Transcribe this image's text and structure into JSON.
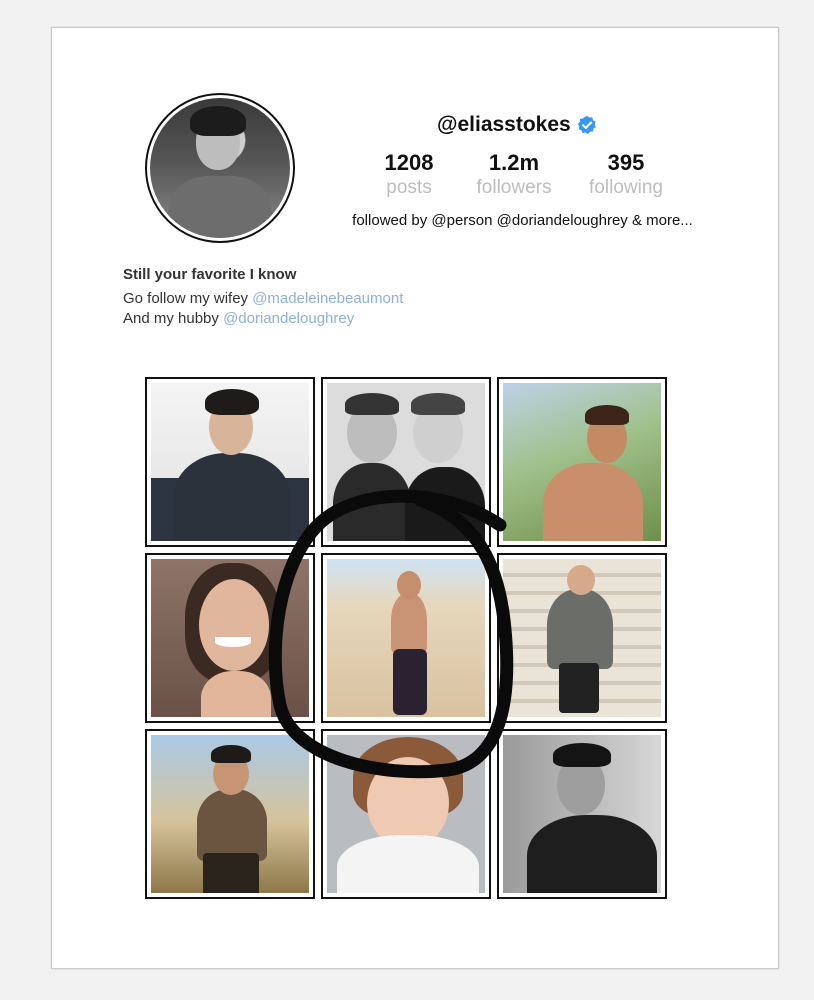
{
  "profile": {
    "handle": "@eliasstokes",
    "verified_icon": "verified-badge-icon",
    "accent_color": "#3897f0",
    "stats": [
      {
        "value": "1208",
        "label": "posts"
      },
      {
        "value": "1.2m",
        "label": "followers"
      },
      {
        "value": "395",
        "label": "following"
      }
    ],
    "followed_by": "followed by @person @doriandeloughrey  & more..."
  },
  "bio": {
    "title": "Still your favorite I know",
    "line1_text": "Go follow my wifey ",
    "line1_mention": "@madeleinebeaumont",
    "line2_text": "And my hubby ",
    "line2_mention": "@doriandeloughrey",
    "mention_color": "#8fb0d8"
  },
  "grid": {
    "posts": [
      {
        "name": "post-man-denim-jacket"
      },
      {
        "name": "post-two-children-bw"
      },
      {
        "name": "post-shirtless-palm-trees"
      },
      {
        "name": "post-smiling-woman"
      },
      {
        "name": "post-man-desert-sand"
      },
      {
        "name": "post-boy-stairs"
      },
      {
        "name": "post-man-festival"
      },
      {
        "name": "post-girl-white-hoodie"
      },
      {
        "name": "post-man-bw-jacket"
      }
    ]
  }
}
